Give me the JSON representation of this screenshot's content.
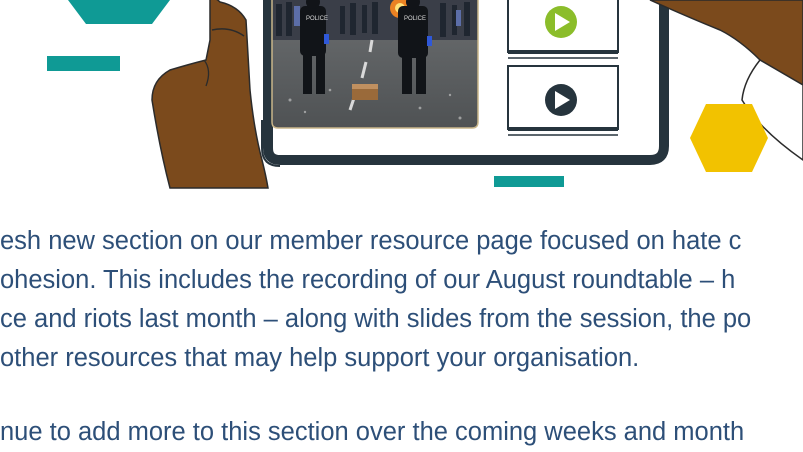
{
  "article": {
    "lines": [
      "esh new section on our member resource page focused on hate c",
      "ohesion. This includes the recording of our August roundtable – h",
      "ce and riots last month – along with slides from the session, the po",
      " other resources that may help support your organisation."
    ],
    "next_line": "nue to add more to this section over the coming weeks and month"
  },
  "illustration": {
    "photo_badges": [
      "POLICE",
      "POLICE"
    ],
    "colors": {
      "teal": "#0f9a95",
      "skin": "#7b4a1c",
      "frame": "#26343d",
      "yellow": "#f2c200",
      "play_green": "#8bbd2a",
      "text_blue": "#2d4f78"
    },
    "icons": [
      "play-green-icon",
      "play-dark-icon"
    ]
  }
}
